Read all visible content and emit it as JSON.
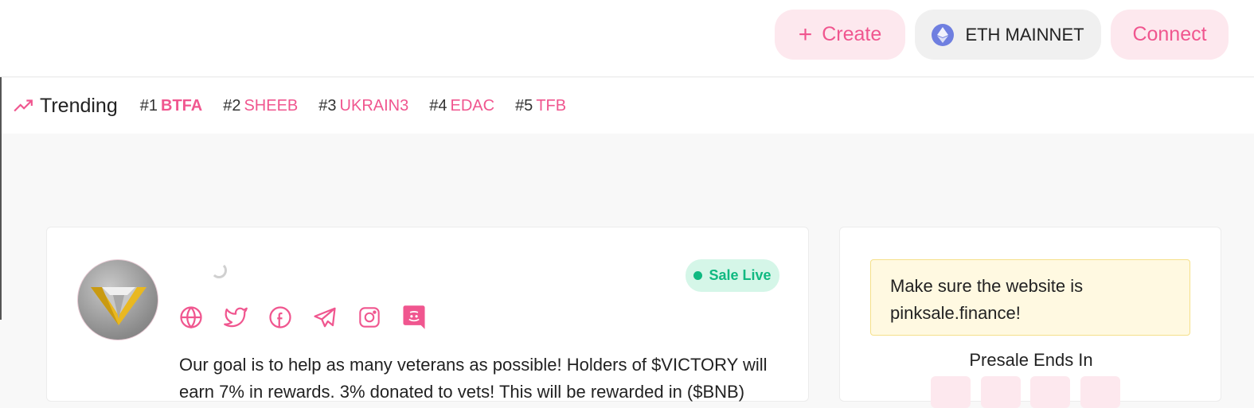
{
  "header": {
    "create_label": "Create",
    "network_label": "ETH MAINNET",
    "connect_label": "Connect"
  },
  "trending": {
    "title": "Trending",
    "items": [
      {
        "rank": "#1",
        "token": "BTFA"
      },
      {
        "rank": "#2",
        "token": "SHEEB"
      },
      {
        "rank": "#3",
        "token": "UKRAIN3"
      },
      {
        "rank": "#4",
        "token": "EDAC"
      },
      {
        "rank": "#5",
        "token": "TFB"
      }
    ]
  },
  "project": {
    "status": "Sale Live",
    "socials": [
      "website-icon",
      "twitter-icon",
      "facebook-icon",
      "telegram-icon",
      "instagram-icon",
      "discord-icon"
    ],
    "description": "Our goal is to help as many veterans as possible! Holders of $VICTORY will earn 7% in rewards. 3% donated to vets! This will be rewarded in ($BNB)"
  },
  "sidebar": {
    "warning": "Make sure the website is pinksale.finance!",
    "presale_title": "Presale Ends In"
  },
  "colors": {
    "accent": "#f0568f",
    "live": "#10b981"
  }
}
